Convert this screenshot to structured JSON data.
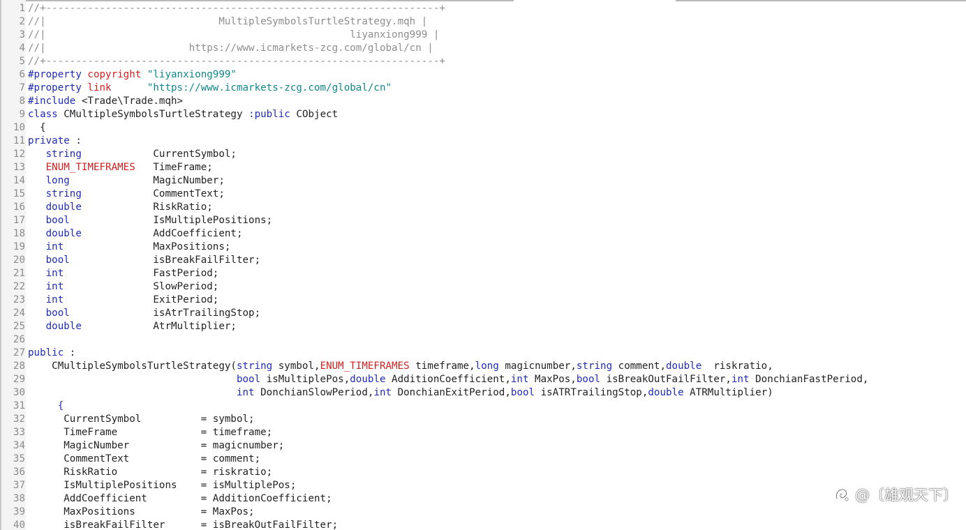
{
  "editor": {
    "lines": [
      {
        "n": "1",
        "tokens": [
          {
            "t": "cm",
            "v": "//+------------------------------------------------------------------+"
          }
        ]
      },
      {
        "n": "2",
        "tokens": [
          {
            "t": "cm",
            "v": "//|                             MultipleSymbolsTurtleStrategy.mqh |"
          }
        ]
      },
      {
        "n": "3",
        "tokens": [
          {
            "t": "cm",
            "v": "//|                                                   liyanxiong999 |"
          }
        ]
      },
      {
        "n": "4",
        "tokens": [
          {
            "t": "cm",
            "v": "//|                        https://www.icmarkets-zcg.com/global/cn |"
          }
        ]
      },
      {
        "n": "5",
        "tokens": [
          {
            "t": "cm",
            "v": "//+------------------------------------------------------------------+"
          }
        ]
      },
      {
        "n": "6",
        "tokens": [
          {
            "t": "kw",
            "v": "#property"
          },
          {
            "t": "id",
            "v": " "
          },
          {
            "t": "kr",
            "v": "copyright"
          },
          {
            "t": "id",
            "v": " "
          },
          {
            "t": "st",
            "v": "\"liyanxiong999\""
          }
        ]
      },
      {
        "n": "7",
        "tokens": [
          {
            "t": "kw",
            "v": "#property"
          },
          {
            "t": "id",
            "v": " "
          },
          {
            "t": "kr",
            "v": "link"
          },
          {
            "t": "id",
            "v": "      "
          },
          {
            "t": "st",
            "v": "\"https://www.icmarkets-zcg.com/global/cn\""
          }
        ]
      },
      {
        "n": "8",
        "tokens": [
          {
            "t": "kw",
            "v": "#include"
          },
          {
            "t": "id",
            "v": " <Trade\\Trade.mqh>"
          }
        ]
      },
      {
        "n": "9",
        "tokens": [
          {
            "t": "kw",
            "v": "class"
          },
          {
            "t": "id",
            "v": " CMultipleSymbolsTurtleStrategy "
          },
          {
            "t": "kw",
            "v": ":public"
          },
          {
            "t": "id",
            "v": " CObject"
          }
        ]
      },
      {
        "n": "10",
        "tokens": [
          {
            "t": "id",
            "v": "  {"
          }
        ]
      },
      {
        "n": "11",
        "tokens": [
          {
            "t": "kw",
            "v": "private"
          },
          {
            "t": "id",
            "v": " :"
          }
        ]
      },
      {
        "n": "12",
        "tokens": [
          {
            "t": "id",
            "v": "   "
          },
          {
            "t": "kw",
            "v": "string"
          },
          {
            "t": "id",
            "v": "            CurrentSymbol;"
          }
        ]
      },
      {
        "n": "13",
        "tokens": [
          {
            "t": "id",
            "v": "   "
          },
          {
            "t": "kr",
            "v": "ENUM_TIMEFRAMES"
          },
          {
            "t": "id",
            "v": "   TimeFrame;"
          }
        ]
      },
      {
        "n": "14",
        "tokens": [
          {
            "t": "id",
            "v": "   "
          },
          {
            "t": "kw",
            "v": "long"
          },
          {
            "t": "id",
            "v": "              MagicNumber;"
          }
        ]
      },
      {
        "n": "15",
        "tokens": [
          {
            "t": "id",
            "v": "   "
          },
          {
            "t": "kw",
            "v": "string"
          },
          {
            "t": "id",
            "v": "            CommentText;"
          }
        ]
      },
      {
        "n": "16",
        "tokens": [
          {
            "t": "id",
            "v": "   "
          },
          {
            "t": "kw",
            "v": "double"
          },
          {
            "t": "id",
            "v": "            RiskRatio;"
          }
        ]
      },
      {
        "n": "17",
        "tokens": [
          {
            "t": "id",
            "v": "   "
          },
          {
            "t": "kw",
            "v": "bool"
          },
          {
            "t": "id",
            "v": "              IsMultiplePositions;"
          }
        ]
      },
      {
        "n": "18",
        "tokens": [
          {
            "t": "id",
            "v": "   "
          },
          {
            "t": "kw",
            "v": "double"
          },
          {
            "t": "id",
            "v": "            AddCoefficient;"
          }
        ]
      },
      {
        "n": "19",
        "tokens": [
          {
            "t": "id",
            "v": "   "
          },
          {
            "t": "kw",
            "v": "int"
          },
          {
            "t": "id",
            "v": "               MaxPositions;"
          }
        ]
      },
      {
        "n": "20",
        "tokens": [
          {
            "t": "id",
            "v": "   "
          },
          {
            "t": "kw",
            "v": "bool"
          },
          {
            "t": "id",
            "v": "              isBreakFailFilter;"
          }
        ]
      },
      {
        "n": "21",
        "tokens": [
          {
            "t": "id",
            "v": "   "
          },
          {
            "t": "kw",
            "v": "int"
          },
          {
            "t": "id",
            "v": "               FastPeriod;"
          }
        ]
      },
      {
        "n": "22",
        "tokens": [
          {
            "t": "id",
            "v": "   "
          },
          {
            "t": "kw",
            "v": "int"
          },
          {
            "t": "id",
            "v": "               SlowPeriod;"
          }
        ]
      },
      {
        "n": "23",
        "tokens": [
          {
            "t": "id",
            "v": "   "
          },
          {
            "t": "kw",
            "v": "int"
          },
          {
            "t": "id",
            "v": "               ExitPeriod;"
          }
        ]
      },
      {
        "n": "24",
        "tokens": [
          {
            "t": "id",
            "v": "   "
          },
          {
            "t": "kw",
            "v": "bool"
          },
          {
            "t": "id",
            "v": "              isAtrTrailingStop;"
          }
        ]
      },
      {
        "n": "25",
        "tokens": [
          {
            "t": "id",
            "v": "   "
          },
          {
            "t": "kw",
            "v": "double"
          },
          {
            "t": "id",
            "v": "            AtrMultiplier;"
          }
        ]
      },
      {
        "n": "26",
        "tokens": []
      },
      {
        "n": "27",
        "tokens": [
          {
            "t": "kw",
            "v": "public"
          },
          {
            "t": "id",
            "v": " :"
          }
        ]
      },
      {
        "n": "28",
        "tokens": [
          {
            "t": "id",
            "v": "    CMultipleSymbolsTurtleStrategy("
          },
          {
            "t": "kw",
            "v": "string"
          },
          {
            "t": "id",
            "v": " symbol,"
          },
          {
            "t": "kr",
            "v": "ENUM_TIMEFRAMES"
          },
          {
            "t": "id",
            "v": " timeframe,"
          },
          {
            "t": "kw",
            "v": "long"
          },
          {
            "t": "id",
            "v": " magicnumber,"
          },
          {
            "t": "kw",
            "v": "string"
          },
          {
            "t": "id",
            "v": " comment,"
          },
          {
            "t": "kw",
            "v": "double"
          },
          {
            "t": "id",
            "v": "  riskratio,"
          }
        ]
      },
      {
        "n": "29",
        "tokens": [
          {
            "t": "id",
            "v": "                                   "
          },
          {
            "t": "kw",
            "v": "bool"
          },
          {
            "t": "id",
            "v": " isMultiplePos,"
          },
          {
            "t": "kw",
            "v": "double"
          },
          {
            "t": "id",
            "v": " AdditionCoefficient,"
          },
          {
            "t": "kw",
            "v": "int"
          },
          {
            "t": "id",
            "v": " MaxPos,"
          },
          {
            "t": "kw",
            "v": "bool"
          },
          {
            "t": "id",
            "v": " isBreakOutFailFilter,"
          },
          {
            "t": "kw",
            "v": "int"
          },
          {
            "t": "id",
            "v": " DonchianFastPeriod,"
          }
        ]
      },
      {
        "n": "30",
        "tokens": [
          {
            "t": "id",
            "v": "                                   "
          },
          {
            "t": "kw",
            "v": "int"
          },
          {
            "t": "id",
            "v": " DonchianSlowPeriod,"
          },
          {
            "t": "kw",
            "v": "int"
          },
          {
            "t": "id",
            "v": " DonchianExitPeriod,"
          },
          {
            "t": "kw",
            "v": "bool"
          },
          {
            "t": "id",
            "v": " isATRTrailingStop,"
          },
          {
            "t": "kw",
            "v": "double"
          },
          {
            "t": "id",
            "v": " ATRMultiplier)"
          }
        ]
      },
      {
        "n": "31",
        "tokens": [
          {
            "t": "id",
            "v": "     "
          },
          {
            "t": "kw",
            "v": "{"
          }
        ]
      },
      {
        "n": "32",
        "tokens": [
          {
            "t": "id",
            "v": "      CurrentSymbol          = symbol;"
          }
        ]
      },
      {
        "n": "33",
        "tokens": [
          {
            "t": "id",
            "v": "      TimeFrame              = timeframe;"
          }
        ]
      },
      {
        "n": "34",
        "tokens": [
          {
            "t": "id",
            "v": "      MagicNumber            = magicnumber;"
          }
        ]
      },
      {
        "n": "35",
        "tokens": [
          {
            "t": "id",
            "v": "      CommentText            = comment;"
          }
        ]
      },
      {
        "n": "36",
        "tokens": [
          {
            "t": "id",
            "v": "      RiskRatio              = riskratio;"
          }
        ]
      },
      {
        "n": "37",
        "tokens": [
          {
            "t": "id",
            "v": "      IsMultiplePositions    = isMultiplePos;"
          }
        ]
      },
      {
        "n": "38",
        "tokens": [
          {
            "t": "id",
            "v": "      AddCoefficient         = AdditionCoefficient;"
          }
        ]
      },
      {
        "n": "39",
        "tokens": [
          {
            "t": "id",
            "v": "      MaxPositions           = MaxPos;"
          }
        ]
      },
      {
        "n": "40",
        "tokens": [
          {
            "t": "id",
            "v": "      isBreakFailFilter      = isBreakOutFailFilter;"
          }
        ]
      }
    ]
  },
  "watermark": {
    "text": "@〔雄观天下〕",
    "icon": "zhihu-logo-icon"
  }
}
